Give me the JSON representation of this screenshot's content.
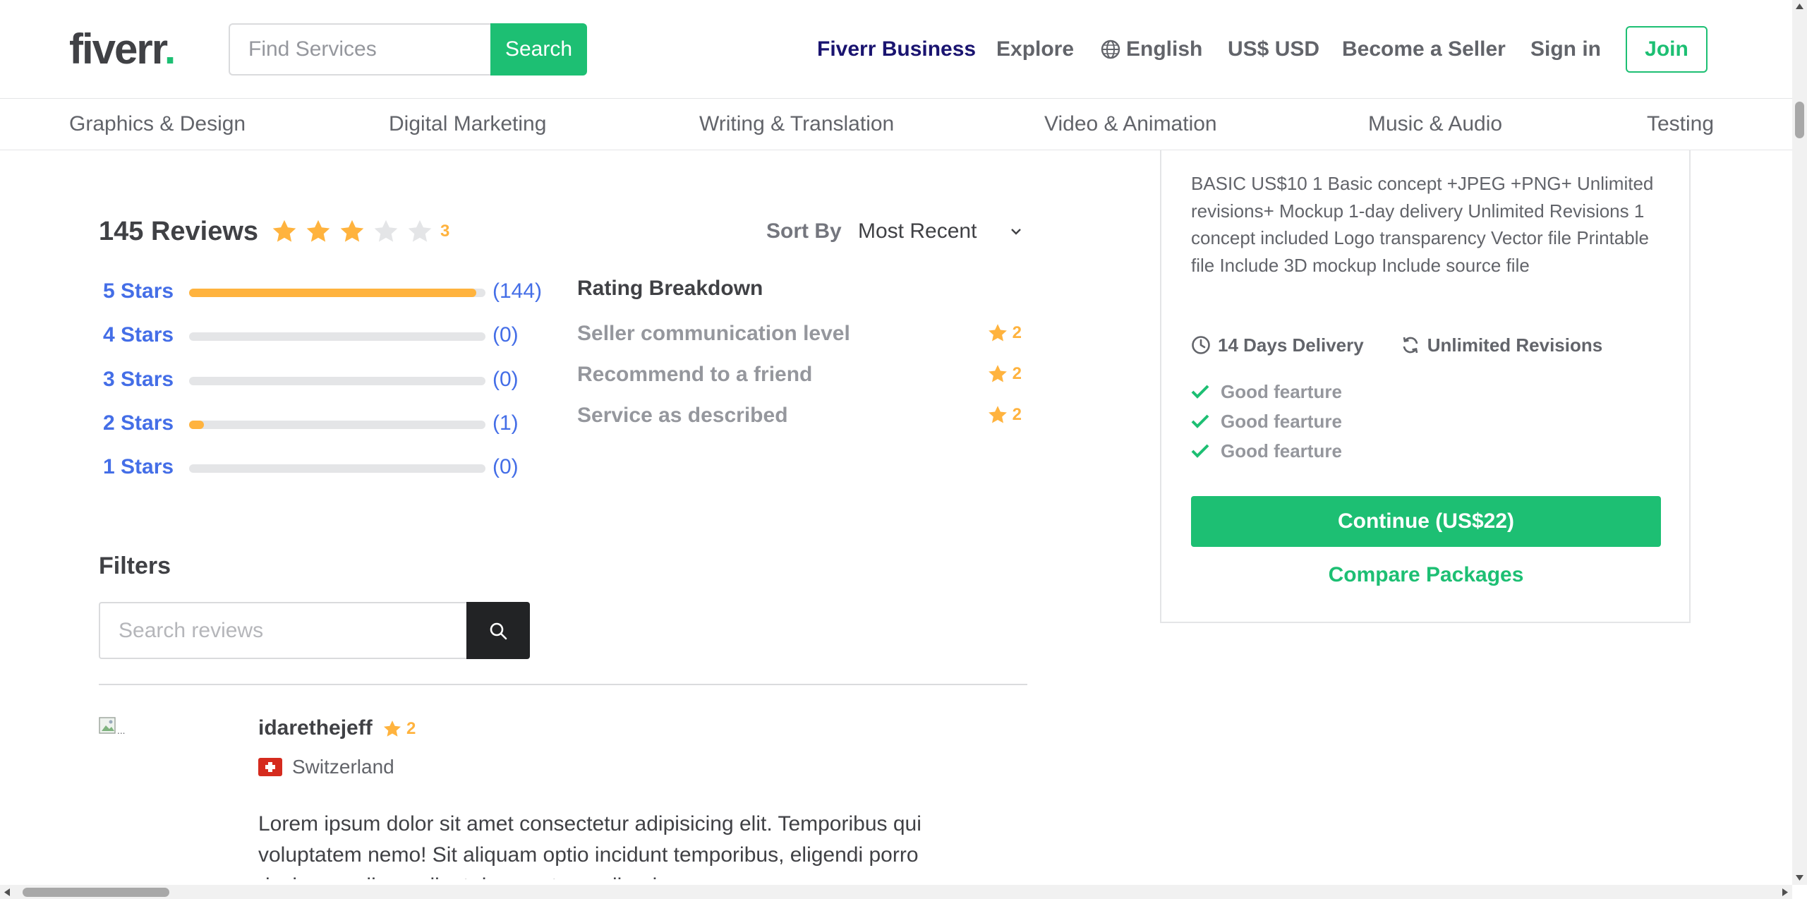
{
  "header": {
    "logo_text": "fiverr",
    "logo_dot": ".",
    "search_placeholder": "Find Services",
    "search_button": "Search",
    "nav": {
      "business": "Fiverr Business",
      "explore": "Explore",
      "language": "English",
      "currency": "US$ USD",
      "become_seller": "Become a Seller",
      "sign_in": "Sign in",
      "join": "Join"
    }
  },
  "categories": [
    "Graphics & Design",
    "Digital Marketing",
    "Writing & Translation",
    "Video & Animation",
    "Music & Audio",
    "Testing"
  ],
  "reviews": {
    "title": "145 Reviews",
    "rating": "3",
    "rating_value": 3,
    "rating_max": 5,
    "sort_label": "Sort By",
    "sort_value": "Most Recent",
    "star_rows": [
      {
        "label": "5 Stars",
        "count": "(144)",
        "fraction": 0.97
      },
      {
        "label": "4 Stars",
        "count": "(0)",
        "fraction": 0
      },
      {
        "label": "3 Stars",
        "count": "(0)",
        "fraction": 0
      },
      {
        "label": "2 Stars",
        "count": "(1)",
        "fraction": 0.05
      },
      {
        "label": "1 Stars",
        "count": "(0)",
        "fraction": 0
      }
    ],
    "breakdown_title": "Rating Breakdown",
    "breakdown": [
      {
        "label": "Seller communication level",
        "value": "2"
      },
      {
        "label": "Recommend to a friend",
        "value": "2"
      },
      {
        "label": "Service as described",
        "value": "2"
      }
    ],
    "filters_title": "Filters",
    "filter_placeholder": "Search reviews",
    "items": [
      {
        "user": "idarethejeff",
        "rating": "2",
        "country": "Switzerland",
        "text": "Lorem ipsum dolor sit amet consectetur adipisicing elit. Temporibus qui voluptatem nemo! Sit aliquam optio incidunt temporibus, eligendi porro dusimus nulla modi, ut deserunt repudiandae"
      }
    ]
  },
  "package": {
    "description": "BASIC US$10 1 Basic concept +JPEG +PNG+ Unlimited revisions+ Mockup 1-day delivery Unlimited Revisions 1 concept included Logo transparency Vector file Printable file Include 3D mockup Include source file",
    "delivery": "14 Days Delivery",
    "revisions": "Unlimited Revisions",
    "features": [
      "Good fearture",
      "Good fearture",
      "Good fearture"
    ],
    "continue": "Continue (US$22)",
    "compare": "Compare Packages"
  },
  "colors": {
    "brand_green": "#1dbf73",
    "star": "#ffb33e",
    "link_blue": "#446ee7",
    "business_navy": "#1a1470"
  }
}
